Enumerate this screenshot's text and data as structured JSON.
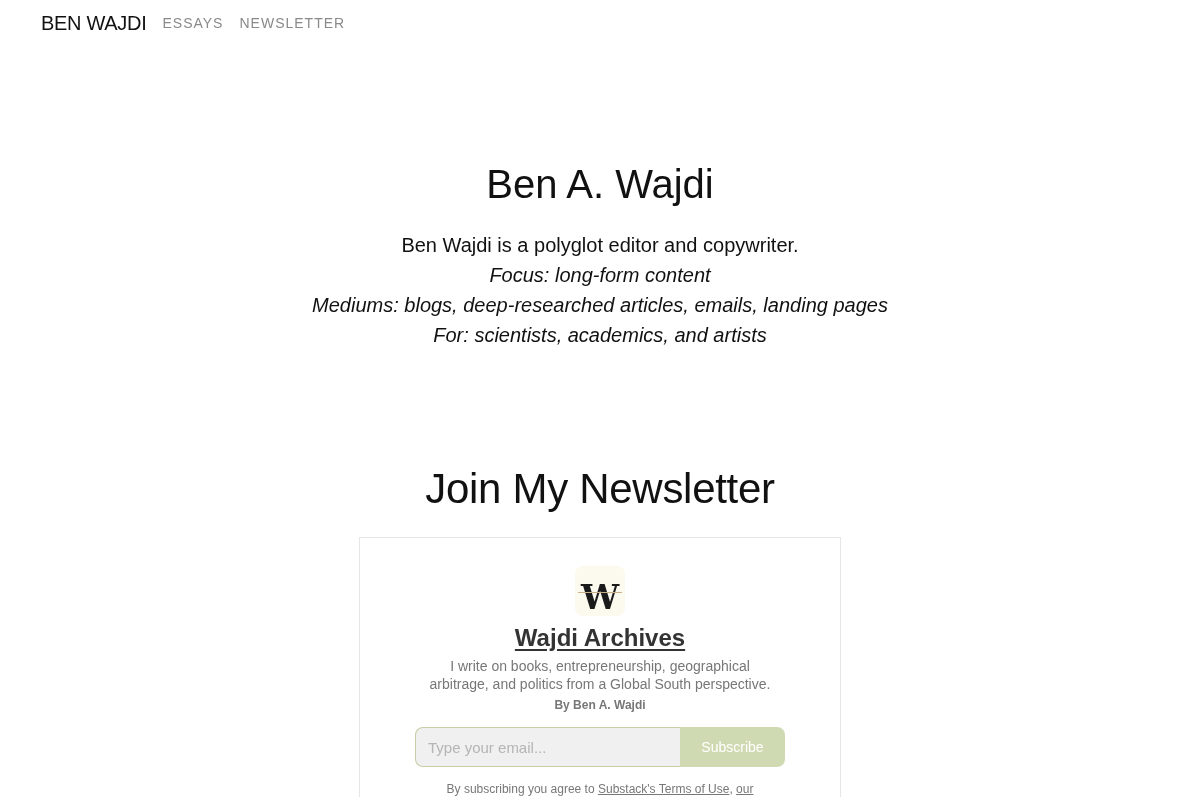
{
  "nav": {
    "brand": "BEN WAJDI",
    "links": [
      {
        "label": "ESSAYS"
      },
      {
        "label": "NEWSLETTER"
      }
    ]
  },
  "hero": {
    "title": "Ben A. Wajdi",
    "lines": [
      {
        "text": "Ben Wajdi is a polyglot editor and copywriter.",
        "italic": false
      },
      {
        "text": "Focus: long-form content",
        "italic": true
      },
      {
        "text": "Mediums: blogs, deep-researched articles, emails, landing pages",
        "italic": true
      },
      {
        "text": "For: scientists, academics, and artists",
        "italic": true
      }
    ]
  },
  "newsletter": {
    "heading": "Join My Newsletter",
    "publication": {
      "logo_letter": "W",
      "name": "Wajdi Archives",
      "description": "I write on books, entrepreneurship, geographical arbitrage, and politics from a Global South perspective.",
      "byline": "By Ben A. Wajdi"
    },
    "email": {
      "placeholder": "Type your email..."
    },
    "button": "Subscribe",
    "consent": [
      {
        "kind": "text",
        "text": "By subscribing you agree to "
      },
      {
        "kind": "link",
        "text": "Substack's Terms of Use"
      },
      {
        "kind": "text",
        "text": ", "
      },
      {
        "kind": "link",
        "text": "our"
      }
    ]
  }
}
